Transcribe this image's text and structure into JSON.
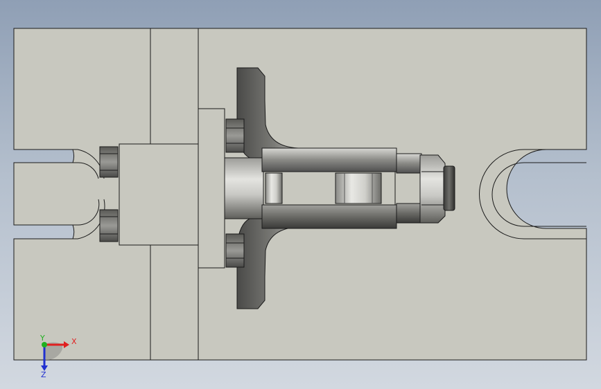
{
  "viewport": {
    "background_top": "#8f9fb5",
    "background_bottom": "#d2d8e0",
    "plate_color": "#c8c8bf",
    "edge_color": "#1a1a1a"
  },
  "triad": {
    "x_label": "X",
    "y_label": "Y",
    "z_label": "Z",
    "x_color": "#e02020",
    "y_color": "#20b020",
    "z_color": "#2030d0"
  }
}
